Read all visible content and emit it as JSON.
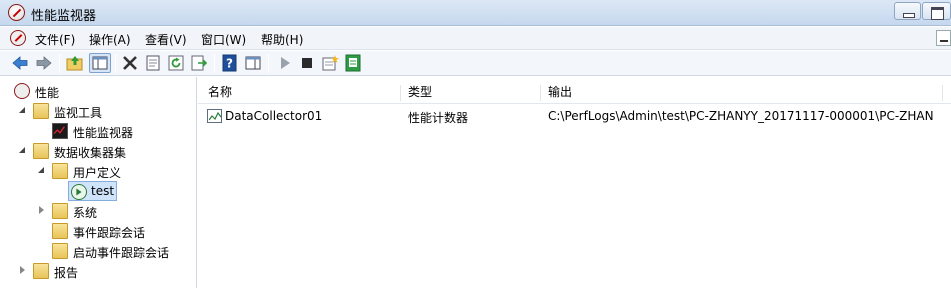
{
  "window": {
    "title": "性能监视器"
  },
  "menu": {
    "items": [
      {
        "label": "文件(F)"
      },
      {
        "label": "操作(A)"
      },
      {
        "label": "查看(V)"
      },
      {
        "label": "窗口(W)"
      },
      {
        "label": "帮助(H)"
      }
    ]
  },
  "toolbar": {
    "buttons": [
      "back-icon",
      "forward-icon",
      "up-folder-icon",
      "show-hide-console-tree-icon",
      "delete-icon",
      "properties-icon",
      "refresh-icon",
      "export-list-icon",
      "help-icon",
      "show-hide-action-pane-icon",
      "start-icon",
      "stop-icon",
      "new-icon",
      "report-icon"
    ]
  },
  "tree": {
    "root": "性能",
    "monitoring_tools": "监视工具",
    "performance_monitor": "性能监视器",
    "data_collector_sets": "数据收集器集",
    "user_defined": "用户定义",
    "test": "test",
    "system": "系统",
    "event_trace_sessions": "事件跟踪会话",
    "startup_event_trace_sessions": "启动事件跟踪会话",
    "reports": "报告"
  },
  "list": {
    "columns": [
      "名称",
      "类型",
      "输出"
    ],
    "rows": [
      {
        "name": "DataCollector01",
        "type": "性能计数器",
        "output": "C:\\PerfLogs\\Admin\\test\\PC-ZHANYY_20171117-000001\\PC-ZHAN..."
      }
    ]
  },
  "colors": {
    "accent": "#cfe3fb",
    "title_bar": "#dbe7f5"
  }
}
